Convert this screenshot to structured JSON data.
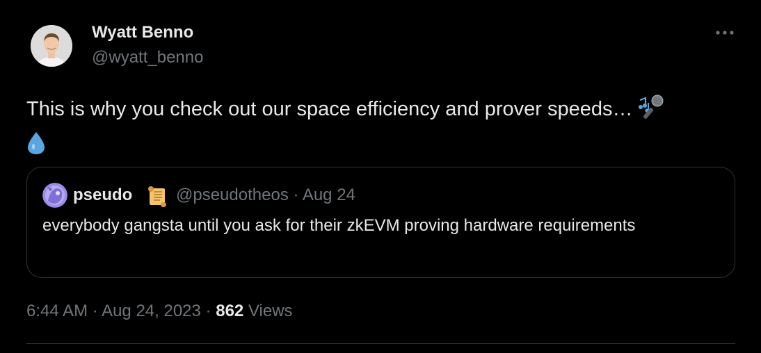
{
  "author": {
    "name": "Wyatt Benno",
    "handle": "@wyatt_benno"
  },
  "tweet": {
    "text": "This is why you check out our space efficiency and prover speeds…",
    "emojis": [
      "microphone-music-emoji",
      "droplet-emoji"
    ]
  },
  "quote": {
    "name": "pseudo",
    "badge_icon": "scroll-emoji",
    "handle": "@pseudotheos",
    "separator": "·",
    "date": "Aug 24",
    "text": "everybody gangsta until you ask for their zkEVM proving hardware requirements"
  },
  "meta": {
    "time": "6:44 AM",
    "separator1": "·",
    "date": "Aug 24, 2023",
    "separator2": "·",
    "views_count": "862",
    "views_label": "Views"
  },
  "colors": {
    "background": "#000000",
    "text_primary": "#e7e9ea",
    "text_secondary": "#71767b",
    "border": "#2f3336"
  }
}
